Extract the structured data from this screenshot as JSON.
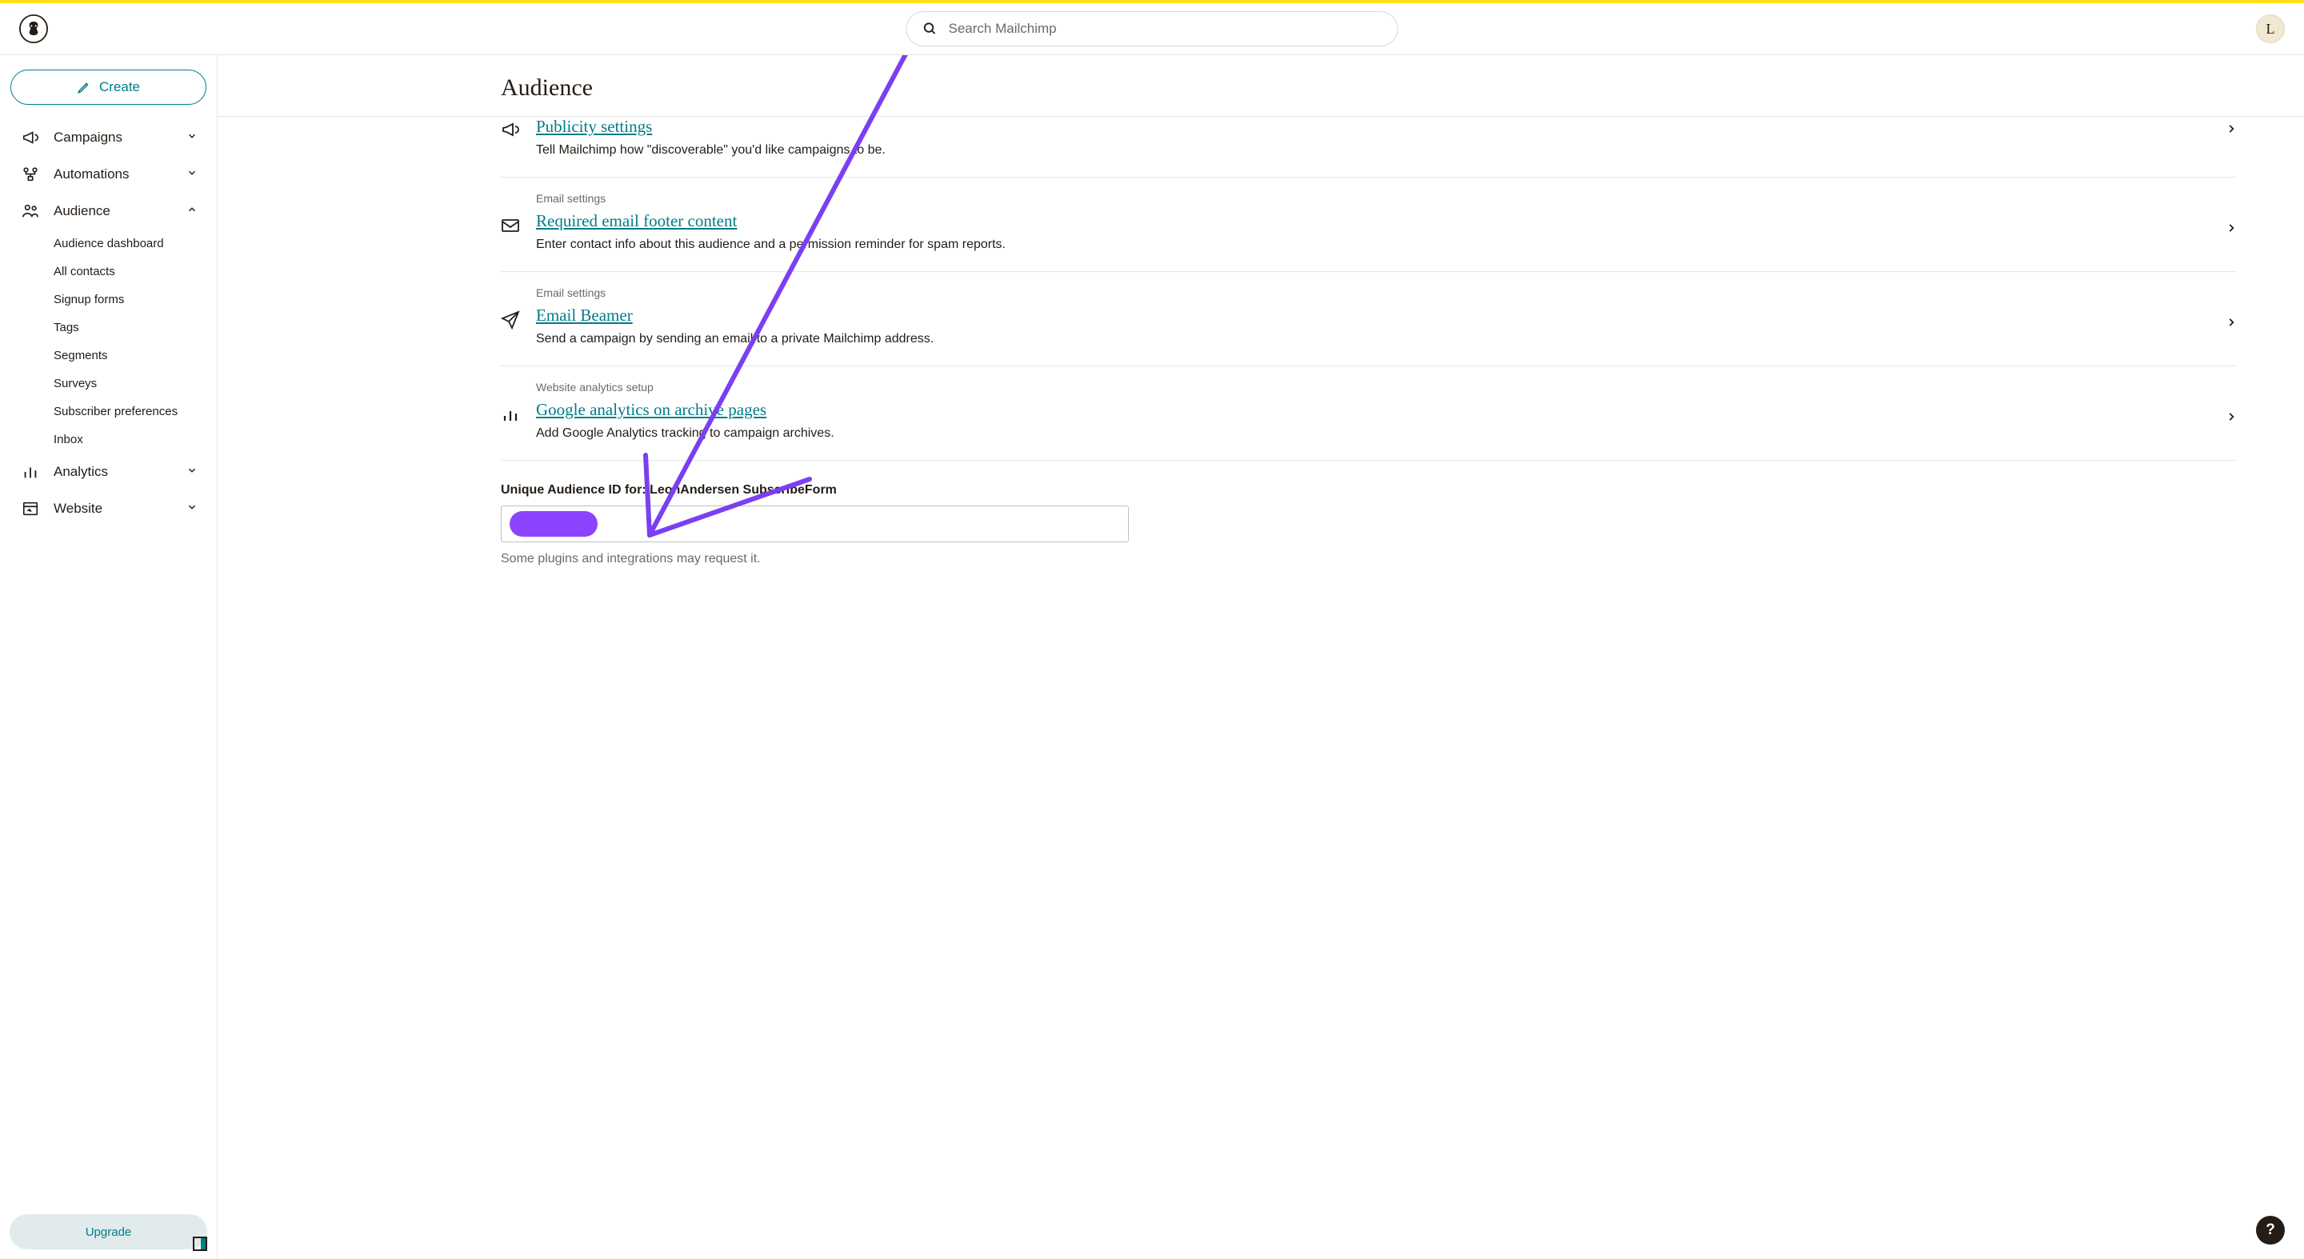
{
  "header": {
    "search_placeholder": "Search Mailchimp",
    "avatar_initial": "L"
  },
  "sidebar": {
    "create_label": "Create",
    "items": [
      {
        "label": "Campaigns",
        "expanded": false
      },
      {
        "label": "Automations",
        "expanded": false
      },
      {
        "label": "Audience",
        "expanded": true
      },
      {
        "label": "Analytics",
        "expanded": false
      },
      {
        "label": "Website",
        "expanded": false
      }
    ],
    "audience_subitems": [
      "Audience dashboard",
      "All contacts",
      "Signup forms",
      "Tags",
      "Segments",
      "Surveys",
      "Subscriber preferences",
      "Inbox"
    ],
    "upgrade_label": "Upgrade"
  },
  "page": {
    "title": "Audience",
    "settings": [
      {
        "category": "",
        "title": "Publicity settings",
        "description": "Tell Mailchimp how \"discoverable\" you'd like campaigns to be.",
        "icon": "megaphone"
      },
      {
        "category": "Email settings",
        "title": "Required email footer content",
        "description": "Enter contact info about this audience and a permission reminder for spam reports.",
        "icon": "envelope"
      },
      {
        "category": "Email settings",
        "title": "Email Beamer",
        "description": "Send a campaign by sending an email to a private Mailchimp address.",
        "icon": "paper-plane"
      },
      {
        "category": "Website analytics setup",
        "title": "Google analytics on archive pages",
        "description": "Add Google Analytics tracking to campaign archives.",
        "icon": "bar-chart"
      }
    ],
    "unique_id": {
      "label": "Unique Audience ID for: LeonAndersen SubscribeForm",
      "help": "Some plugins and integrations may request it."
    }
  }
}
